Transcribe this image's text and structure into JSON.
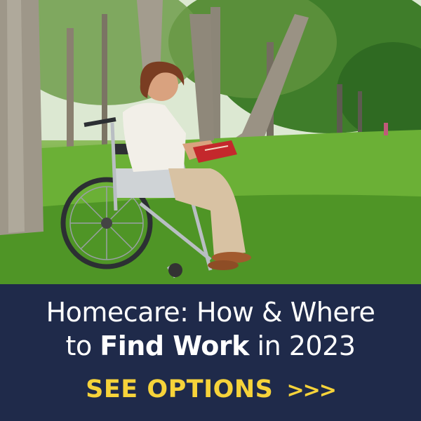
{
  "banner": {
    "headline_line1": "Homecare: How & Where",
    "headline_line2_prefix": "to ",
    "headline_line2_bold": "Find Work",
    "headline_line2_suffix": " in 2023",
    "cta_label": "SEE OPTIONS",
    "cta_arrows": ">>>"
  },
  "colors": {
    "banner_background": "#1f2a4a",
    "headline_text": "#ffffff",
    "cta_text": "#f6d33a",
    "grass": "#5fa52e"
  },
  "icons": {
    "cta_arrows": "triple-chevron-right"
  }
}
